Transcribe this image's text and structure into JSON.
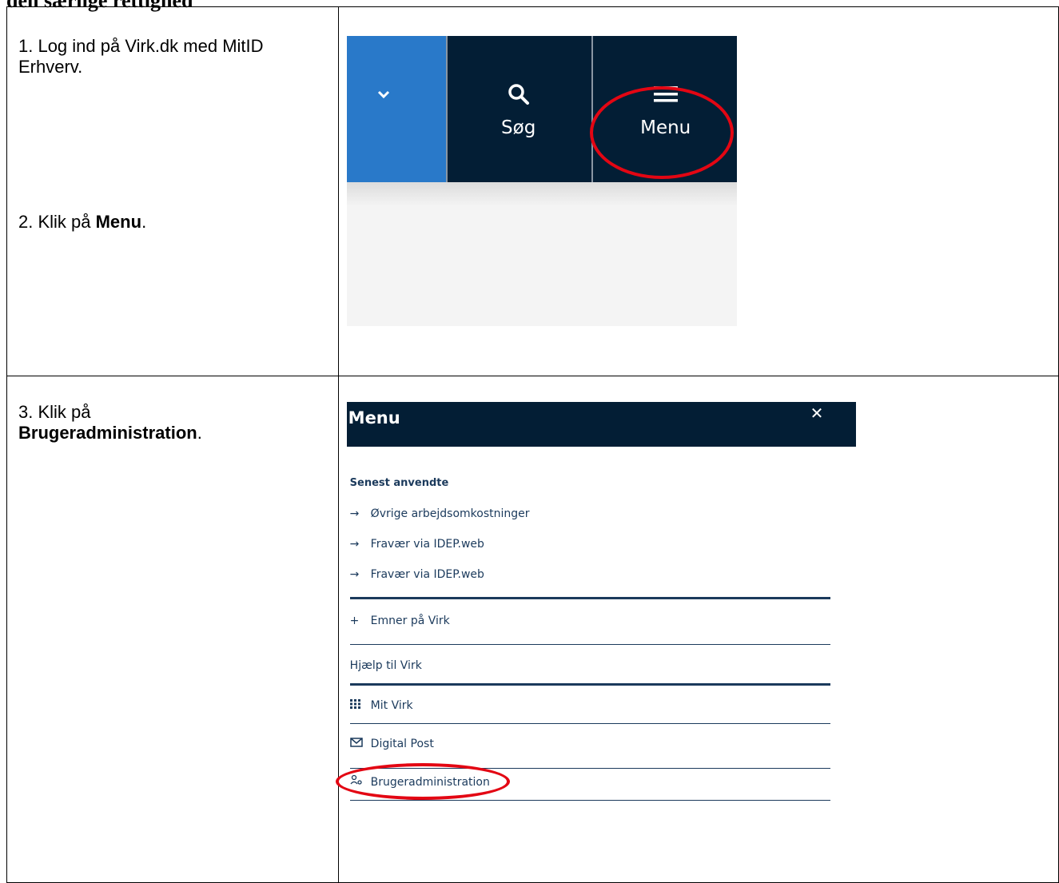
{
  "heading": "den særlige rettighed",
  "step1": "1. Log ind på Virk.dk med MitID Erhverv.",
  "step2_prefix": "2. Klik på ",
  "step2_bold": "Menu",
  "step2_suffix": ".",
  "step3_prefix": "3. Klik på ",
  "step3_bold": "Brugeradministration",
  "step3_suffix": ".",
  "screenshot1": {
    "chevron_icon": "chevron-down-icon",
    "search_icon": "search-icon",
    "search_label": "Søg",
    "menu_icon": "hamburger-icon",
    "menu_label": "Menu"
  },
  "screenshot2": {
    "title": "Menu",
    "close": "✕",
    "recent_heading": "Senest anvendte",
    "recent": [
      "Øvrige arbejdsomkostninger",
      "Fravær via IDEP.web",
      "Fravær via IDEP.web"
    ],
    "topics": "Emner på Virk",
    "help": "Hjælp til Virk",
    "mit_virk": "Mit Virk",
    "digital_post": "Digital Post",
    "brugeradmin": "Brugeradministration"
  },
  "colors": {
    "highlight": "#e30613",
    "navy": "#031e35",
    "blue": "#2979c9"
  }
}
